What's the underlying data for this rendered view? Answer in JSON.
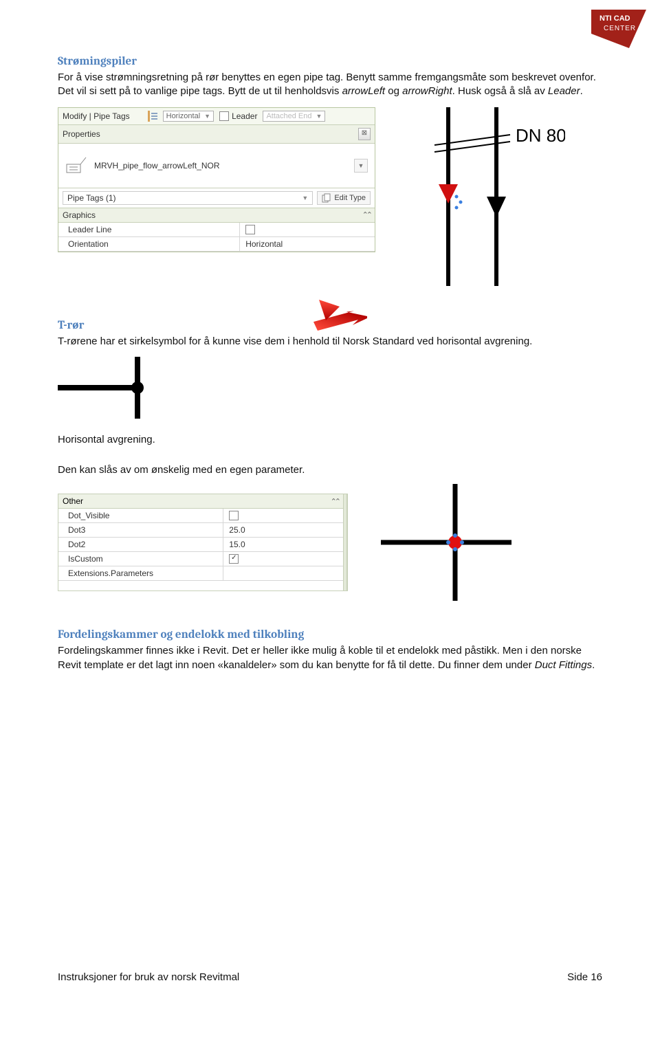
{
  "logo": {
    "line1": "NTI CAD",
    "line2": "CENTER"
  },
  "sections": {
    "stromingspiler": {
      "heading": "Strømingspiler",
      "p1": "For å vise strømningsretning på rør benyttes en egen pipe tag. Benytt samme fremgangsmåte som beskrevet ovenfor. Det vil si sett på to vanlige pipe tags. Bytt de ut til henholdsvis ",
      "i1": "arrowLeft",
      "p2": " og ",
      "i2": "arrowRight",
      "p3": ". Husk også å slå av ",
      "i3": "Leader",
      "p4": "."
    },
    "tror": {
      "heading": "T-rør",
      "p1": "T-rørene har et sirkelsymbol for å kunne vise dem i henhold til Norsk Standard ved horisontal avgrening.",
      "p2": "Horisontal avgrening.",
      "p3": "Den kan slås av om ønskelig med en egen parameter."
    },
    "fordeling": {
      "heading": "Fordelingskammer og endelokk med tilkobling",
      "p1": "Fordelingskammer finnes ikke i Revit. Det er heller ikke mulig å koble til et endelokk med påstikk. Men i den norske Revit template er det lagt inn noen «kanaldeler» som du kan benytte for få til dette. Du finner dem under ",
      "i1": "Duct Fittings",
      "p2": "."
    }
  },
  "ribbon": {
    "context": "Modify | Pipe Tags",
    "orientation": "Horizontal",
    "leader_label": "Leader",
    "attached": "Attached End"
  },
  "properties": {
    "title": "Properties",
    "type_name": "MRVH_pipe_flow_arrowLeft_NOR",
    "instance": "Pipe Tags (1)",
    "edit_type": "Edit Type",
    "group": "Graphics",
    "rows": {
      "leader_line": {
        "label": "Leader Line"
      },
      "orientation": {
        "label": "Orientation",
        "value": "Horizontal"
      }
    }
  },
  "diagram": {
    "label": "DN 80"
  },
  "other_panel": {
    "group": "Other",
    "rows": {
      "dot_visible": {
        "label": "Dot_Visible"
      },
      "dot3": {
        "label": "Dot3",
        "value": "25.0"
      },
      "dot2": {
        "label": "Dot2",
        "value": "15.0"
      },
      "is_custom": {
        "label": "IsCustom"
      },
      "ext": {
        "label": "Extensions.Parameters"
      }
    }
  },
  "footer": {
    "left": "Instruksjoner for bruk av norsk Revitmal",
    "right": "Side 16"
  }
}
